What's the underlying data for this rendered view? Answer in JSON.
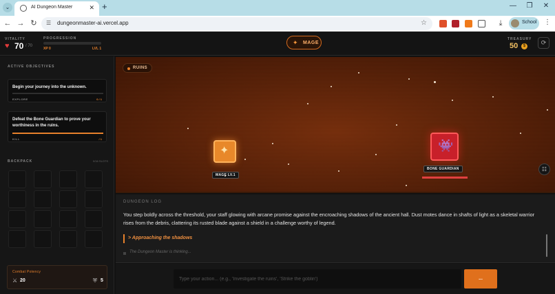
{
  "browser": {
    "tab_title": "AI Dungeon Master",
    "tab_close": "✕",
    "new_tab": "+",
    "url": "dungeonmaster-ai.vercel.app",
    "profile": "School",
    "window_controls": {
      "minimize": "—",
      "restore": "❐",
      "close": "✕"
    }
  },
  "header": {
    "vitality_label": "VITALITY",
    "hp": "70",
    "hp_max": "/ 70",
    "progression_label": "PROGRESSION",
    "xp_progress": 0,
    "xp": "XP 0",
    "level": "LVL 1",
    "class": "MAGE",
    "treasury_label": "TREASURY",
    "gold": "50",
    "coin_symbol": "$"
  },
  "sidebar": {
    "objectives_title": "ACTIVE OBJECTIVES",
    "objectives": [
      {
        "text": "Begin your journey into the unknown.",
        "type": "EXPLORE",
        "count": "0 / 1",
        "progress": 0
      },
      {
        "text": "Defeat the Bone Guardian to prove your worthiness in the ruins.",
        "type": "KILL",
        "count": "/ 1",
        "progress": 1.0
      }
    ],
    "backpack_title": "BACKPACK",
    "backpack_count": "0/16 SLOTS",
    "potency_title": "Combat Potency",
    "attack": "20",
    "defense": "5"
  },
  "scene": {
    "location": "RUINS",
    "player_label": "MAGE LV.1",
    "enemy_label": "BONE GUARDIAN",
    "enemy_hp": 1.0
  },
  "log": {
    "title": "DUNGEON LOG",
    "narration": "You step boldly across the threshold, your staff glowing with arcane promise against the encroaching shadows of the ancient hall. Dust motes dance in shafts of light as a skeletal warrior rises from the debris, clattering its rusted blade against a shield in a challenge worthy of legend.",
    "player_action": "> Approaching the shadows",
    "thinking": "The Dungeon Master is thinking..."
  },
  "input": {
    "placeholder": "Type your action... (e.g., 'Investigate the ruins', 'Strike the goblin')",
    "send_label": "..."
  },
  "colors": {
    "accent": "#e8812c",
    "health": "#e23b3b",
    "gold": "#f2c063",
    "enemy": "#c8202a",
    "player": "#e8882a"
  },
  "icons": {
    "heart": "heart-icon",
    "class": "sparkle-icon",
    "coin": "coin-icon",
    "refresh": "refresh-icon",
    "sword": "sword-icon",
    "shield": "shield-icon",
    "enemy": "space-invader-icon",
    "player": "sparkle-icon"
  }
}
